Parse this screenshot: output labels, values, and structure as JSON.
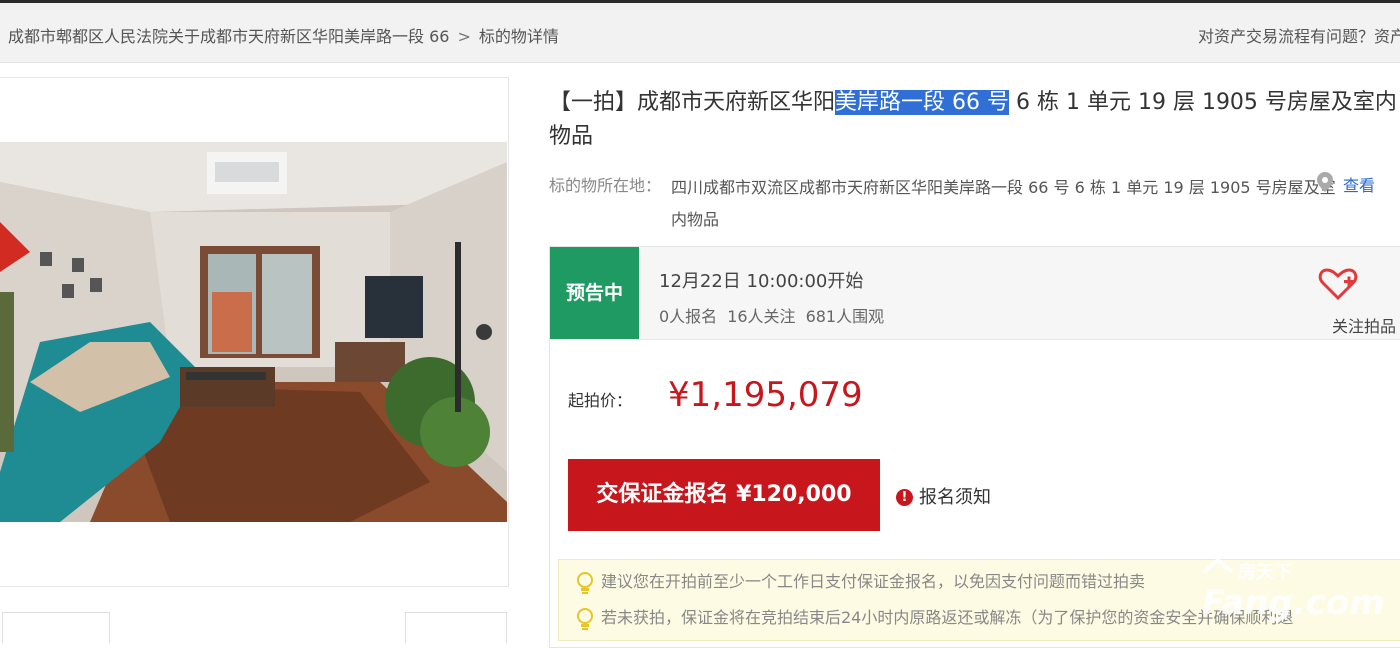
{
  "breadcrumb": {
    "court": "成都市郫都区人民法院关于成都市天府新区华阳美岸路一段 66",
    "separator": ">",
    "current": "标的物详情"
  },
  "help_link": "对资产交易流程有问题？资产",
  "item": {
    "title_prefix": "【一拍】成都市天府新区华阳",
    "title_highlight": "美岸路一段 66 号",
    "title_suffix": " 6 栋 1 单元 19 层 1905 号房屋及室内物品",
    "location_label": "标的物所在地：",
    "location": "四川成都市双流区成都市天府新区华阳美岸路一段 66 号 6 栋 1 单元 19 层 1905 号房屋及室内物品",
    "map_link": "查看"
  },
  "auction": {
    "status": "预告中",
    "start_time": "12月22日 10:00:00开始",
    "registered": "0人报名",
    "followers": "16人关注",
    "viewers": "681人围观",
    "follow_label": "关注拍品",
    "start_price_label": "起拍价：",
    "start_price": "¥1,195,079",
    "deposit_button": "交保证金报名 ¥120,000",
    "notice_link": "报名须知"
  },
  "tips": [
    "建议您在开拍前至少一个工作日支付保证金报名，以免因支付问题而错过拍卖",
    "若未获拍，保证金将在竞拍结束后24小时内原路返还或解冻（为了保护您的资金安全并确保顺利退"
  ],
  "watermark": {
    "cn": "房天下",
    "en": "Fang.com"
  },
  "colors": {
    "accent_red": "#c8161d",
    "status_green": "#1f9a63",
    "highlight_blue": "#2f6fd6"
  },
  "icons": [
    "heart-plus-icon",
    "map-pin-icon",
    "warning-icon",
    "lightbulb-icon"
  ]
}
